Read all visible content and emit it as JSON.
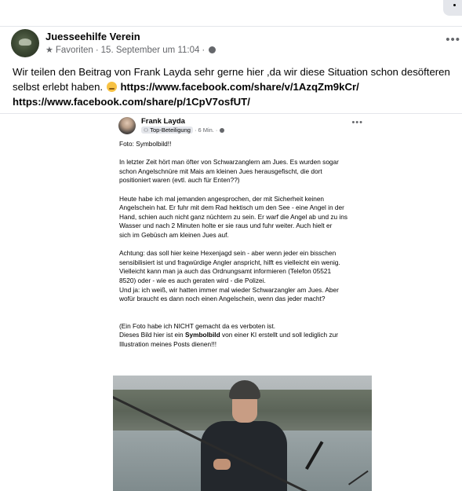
{
  "post": {
    "author": "Juesseehilfe Verein",
    "audience": "Favoriten",
    "date": "15. September um 11:04",
    "text_part1": "Wir teilen den Beitrag von Frank Layda sehr gerne hier ,da wir diese Situation schon desöfteren selbst erlebt haben. ",
    "link1": "https://www.facebook.com/share/v/1AzqZm9kCr/",
    "link2": "https://www.facebook.com/share/p/1CpV7osfUT/",
    "emoji": "disappointed-face"
  },
  "shared": {
    "author": "Frank Layda",
    "badge": "Top-Beteiligung",
    "time": "6 Min.",
    "paragraphs": [
      "Foto: Symbolbild!!",
      "In letzter Zeit hört man öfter von Schwarzanglern am Jues. Es wurden sogar\nschon Angelschnüre mit Mais am kleinen Jues herausgefischt, die dort\npositioniert waren (evtl. auch für Enten??)",
      "Heute habe ich mal jemanden angesprochen, der mit Sicherheit keinen\nAngelschein hat. Er fuhr mit dem Rad hektisch um den See - eine Angel in der\nHand, schien auch nicht ganz nüchtern zu sein. Er warf die Angel ab und zu ins\nWasser und nach 2 Minuten holte er sie raus und fuhr weiter. Auch hielt er\nsich im Gebüsch am kleinen Jues auf.",
      "Achtung: das soll hier keine Hexenjagd sein - aber wenn jeder ein bisschen\nsensibilisiert ist und fragwürdige Angler anspricht, hilft es vielleicht ein wenig.\nVielleicht kann man ja auch das Ordnungsamt informieren (Telefon 05521\n8520) oder - wie es auch geraten wird - die Polizei.\nUnd ja: ich weiß, wir hatten immer mal wieder Schwarzangler am Jues. Aber\nwofür braucht es dann noch einen Angelschein, wenn das jeder macht?"
    ],
    "last_line1": "(Ein Foto habe ich NICHT gemacht da es verboten ist.",
    "last_line2_a": "Dieses Bild hier ist ein ",
    "last_line2_b": "Symbolbild",
    "last_line2_c": " von einer KI erstellt und soll lediglich zur",
    "last_line3": "Illustration meines Posts dienen!!!"
  },
  "icons": {
    "audience": "star-icon",
    "privacy": "globe-icon",
    "more": "more-options-icon"
  },
  "colors": {
    "meta_text": "#65676b",
    "divider": "#e4e6eb"
  }
}
